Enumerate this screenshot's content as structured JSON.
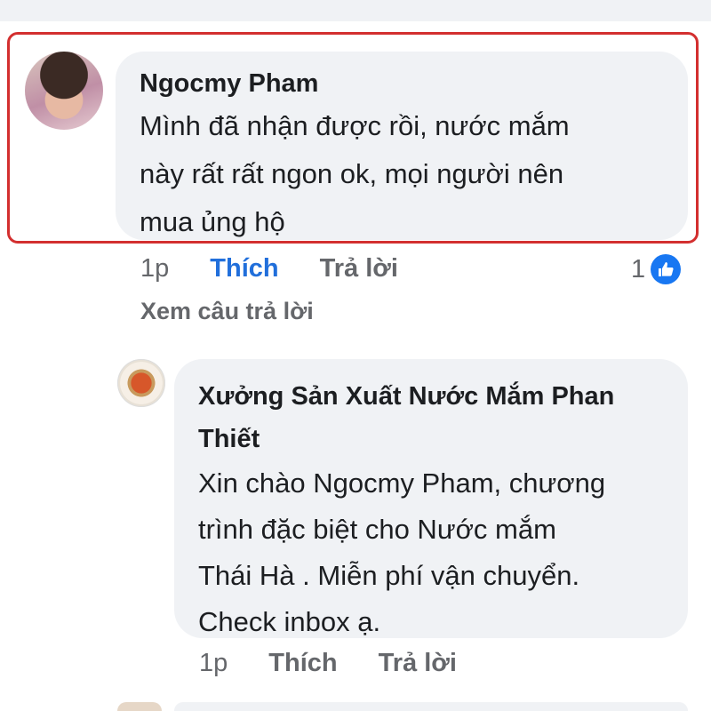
{
  "comments": [
    {
      "author": "Ngocmy Pham",
      "lines": [
        "Mình đã nhận được rồi, nước mắm",
        "này rất rất ngon ok, mọi người nên",
        "mua ủng hộ"
      ],
      "time": "1p",
      "like_label": "Thích",
      "reply_label": "Trả lời",
      "reaction_count": "1",
      "view_replies": "Xem câu trả lời"
    },
    {
      "author_lines": [
        "Xưởng Sản Xuất Nước Mắm Phan",
        "Thiết"
      ],
      "lines": [
        "Xin chào Ngocmy Pham, chương",
        "trình đặc biệt cho Nước mắm",
        "Thái Hà . Miễn phí vận chuyển.",
        "Check inbox ạ."
      ],
      "time": "1p",
      "like_label": "Thích",
      "reply_label": "Trả lời"
    }
  ],
  "colors": {
    "highlight": "#d32f2f",
    "like_active": "#216fdb",
    "reaction_blue": "#1877f2",
    "bubble": "#f0f2f5"
  },
  "icons": {
    "reaction": "thumbs-up-icon"
  }
}
